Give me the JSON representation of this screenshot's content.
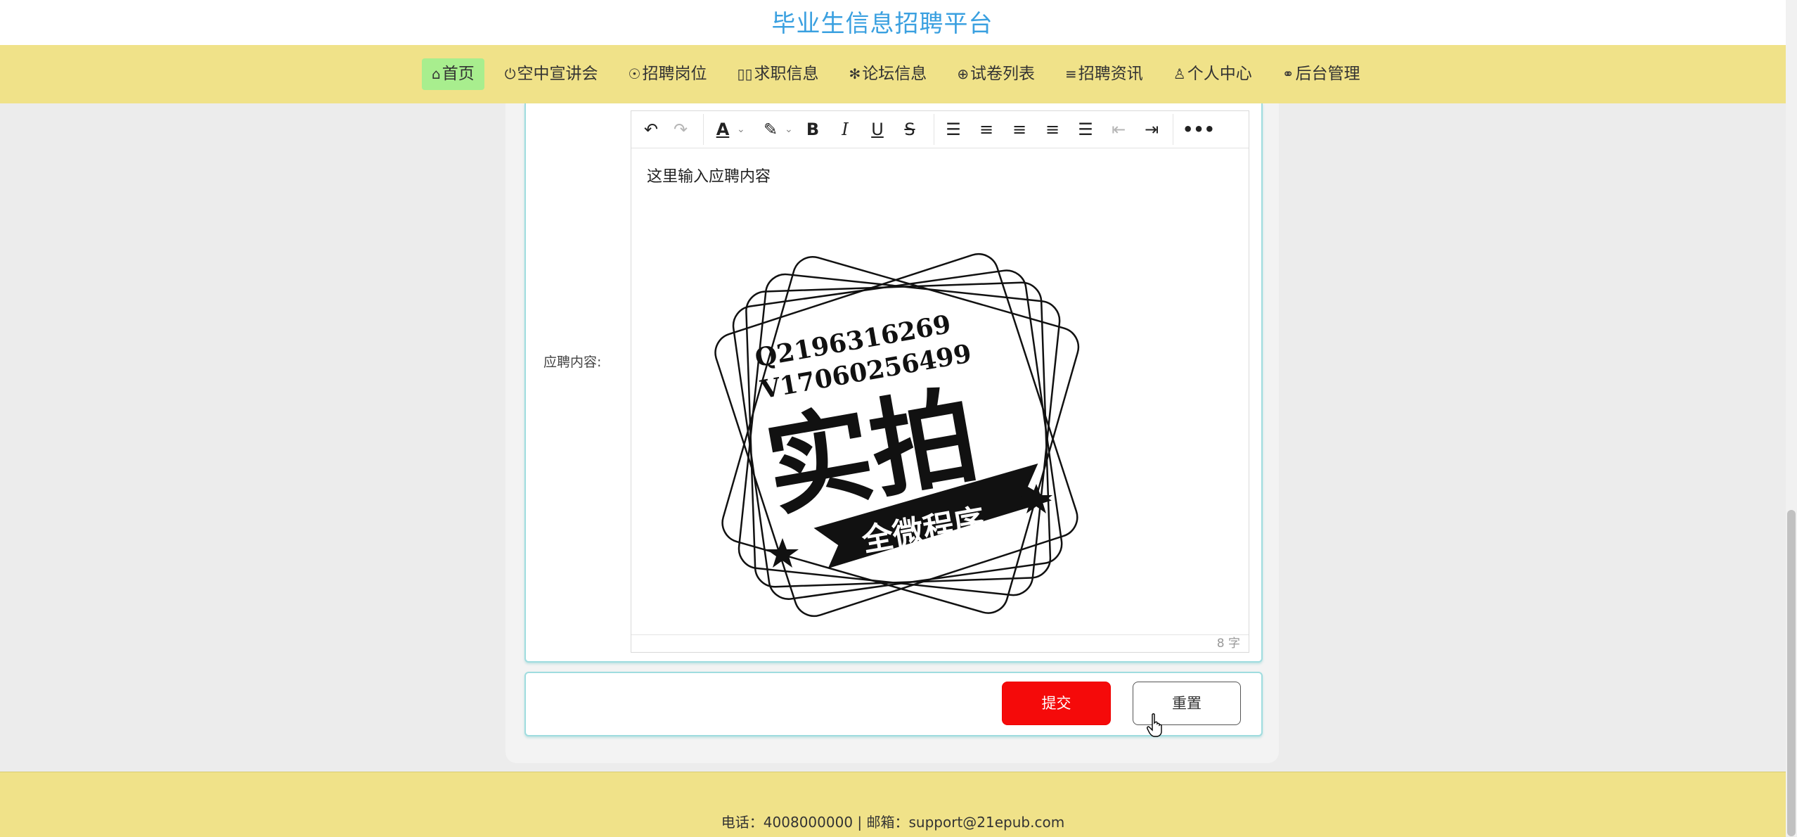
{
  "site": {
    "title": "毕业生信息招聘平台"
  },
  "nav": {
    "items": [
      {
        "label": "首页",
        "icon": "home-icon",
        "glyph": "⌂",
        "active": true
      },
      {
        "label": "空中宣讲会",
        "icon": "power-icon",
        "glyph": "⏻"
      },
      {
        "label": "招聘岗位",
        "icon": "compass-icon",
        "glyph": "☉"
      },
      {
        "label": "求职信息",
        "icon": "placeholder-icon",
        "glyph": "▯▯"
      },
      {
        "label": "论坛信息",
        "icon": "snowflake-icon",
        "glyph": "✻"
      },
      {
        "label": "试卷列表",
        "icon": "globe-icon",
        "glyph": "⊕"
      },
      {
        "label": "招聘资讯",
        "icon": "sliders-icon",
        "glyph": "≡"
      },
      {
        "label": "个人中心",
        "icon": "user-icon",
        "glyph": "♙"
      },
      {
        "label": "后台管理",
        "icon": "link-icon",
        "glyph": "⚭"
      }
    ]
  },
  "form": {
    "content_label": "应聘内容:",
    "editor": {
      "text": "这里输入应聘内容",
      "counter": "8 字",
      "stamp": {
        "line1": "Q2196316269",
        "line2": "V17060256499",
        "main": "实拍",
        "ribbon": "全微程序"
      }
    },
    "submit_label": "提交",
    "reset_label": "重置"
  },
  "footer": {
    "text": "电话：4008000000 | 邮箱：support@21epub.com"
  },
  "colors": {
    "nav_bg": "#f0e289",
    "title": "#3aa0e0",
    "active_nav": "#a8ee8e",
    "submit": "#f50a0a"
  }
}
